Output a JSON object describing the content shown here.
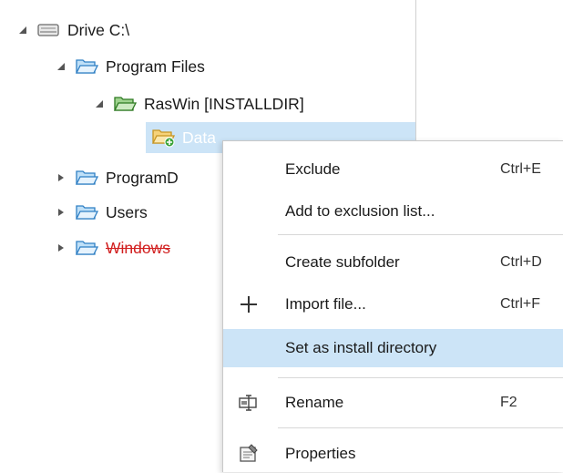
{
  "tree": {
    "items": [
      {
        "label": "Drive C:\\",
        "icon": "drive-icon",
        "expanded": true
      },
      {
        "label": "Program Files",
        "icon": "folder-icon",
        "expanded": true
      },
      {
        "label": "RasWin [INSTALLDIR]",
        "icon": "folder-green-icon",
        "expanded": true
      },
      {
        "label": "Data",
        "icon": "folder-new-icon",
        "selected": true
      },
      {
        "label": "ProgramD",
        "icon": "folder-icon",
        "expanded": false
      },
      {
        "label": "Users",
        "icon": "folder-icon",
        "expanded": false
      },
      {
        "label": "Windows",
        "icon": "folder-icon",
        "expanded": false,
        "excluded": true
      }
    ]
  },
  "context_menu": {
    "items": [
      {
        "label": "Exclude",
        "shortcut": "Ctrl+E"
      },
      {
        "label": "Add to exclusion list..."
      },
      {
        "label": "Create subfolder",
        "shortcut": "Ctrl+D"
      },
      {
        "label": "Import file...",
        "shortcut": "Ctrl+F",
        "icon": "plus-icon"
      },
      {
        "label": "Set as install directory",
        "highlighted": true
      },
      {
        "label": "Rename",
        "shortcut": "F2",
        "icon": "rename-icon"
      },
      {
        "label": "Properties",
        "icon": "properties-icon"
      }
    ]
  },
  "colors": {
    "selection": "#cce4f7",
    "excluded_text": "#d11f1f",
    "folder_blue": "#3b8fd6",
    "folder_green": "#3c8a2e",
    "folder_yellow": "#e9b64a"
  }
}
